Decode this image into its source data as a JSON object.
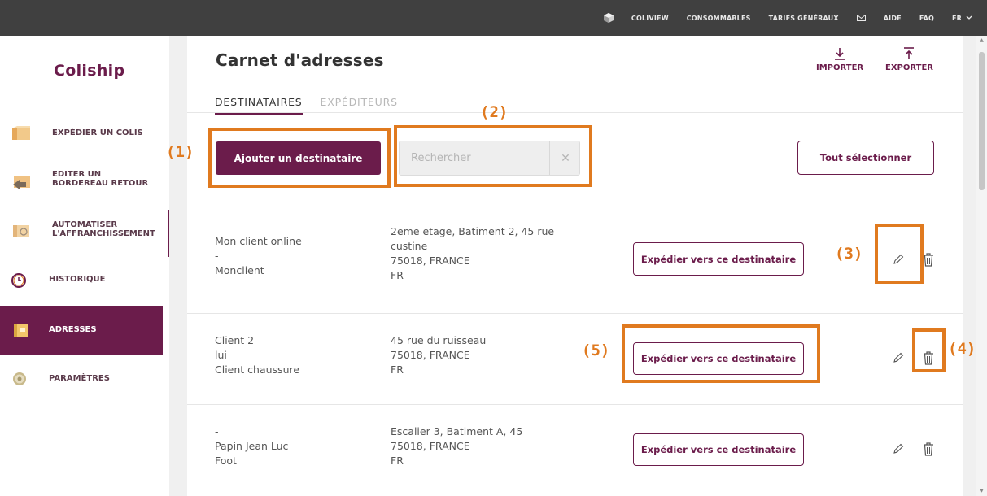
{
  "topbar": {
    "items": [
      "COLIVIEW",
      "CONSOMMABLES",
      "TARIFS GÉNÉRAUX",
      "AIDE",
      "FAQ",
      "FR"
    ]
  },
  "sidebar": {
    "logo": "Coliship",
    "items": [
      {
        "line1": "EXPÉDIER UN COLIS",
        "line2": ""
      },
      {
        "line1": "EDITER UN",
        "line2": "BORDEREAU RETOUR"
      },
      {
        "line1": "AUTOMATISER",
        "line2": "L'AFFRANCHISSEMENT"
      },
      {
        "line1": "HISTORIQUE",
        "line2": ""
      },
      {
        "line1": "ADRESSES",
        "line2": ""
      },
      {
        "line1": "PARAMÈTRES",
        "line2": ""
      }
    ]
  },
  "header": {
    "title": "Carnet d'adresses",
    "import_label": "IMPORTER",
    "export_label": "EXPORTER"
  },
  "tabs": [
    {
      "label": "DESTINATAIRES",
      "active": true
    },
    {
      "label": "EXPÉDITEURS",
      "active": false
    }
  ],
  "toolbar": {
    "add_label": "Ajouter un destinataire",
    "search_placeholder": "Rechercher",
    "clear_glyph": "✕",
    "select_all_label": "Tout sélectionner"
  },
  "rows": [
    {
      "names": [
        "Mon client online",
        "-",
        "Monclient"
      ],
      "address": [
        "2eme etage, Batiment 2, 45 rue",
        "custine",
        "75018, FRANCE",
        "FR"
      ],
      "ship_label": "Expédier vers ce destinataire"
    },
    {
      "names": [
        "Client 2",
        "lui",
        "Client chaussure"
      ],
      "address": [
        "45 rue du ruisseau",
        "75018, FRANCE",
        "FR"
      ],
      "ship_label": "Expédier vers ce destinataire"
    },
    {
      "names": [
        "-",
        "Papin Jean Luc",
        "Foot"
      ],
      "address": [
        "Escalier 3, Batiment A, 45",
        "75018, FRANCE",
        "FR"
      ],
      "ship_label": "Expédier vers ce destinataire"
    }
  ],
  "annotations": [
    "(1)",
    "(2)",
    "(3)",
    "(4)",
    "(5)"
  ],
  "colors": {
    "brand": "#6b1c4b",
    "annotation": "#e07a1f",
    "topbar": "#404040"
  }
}
